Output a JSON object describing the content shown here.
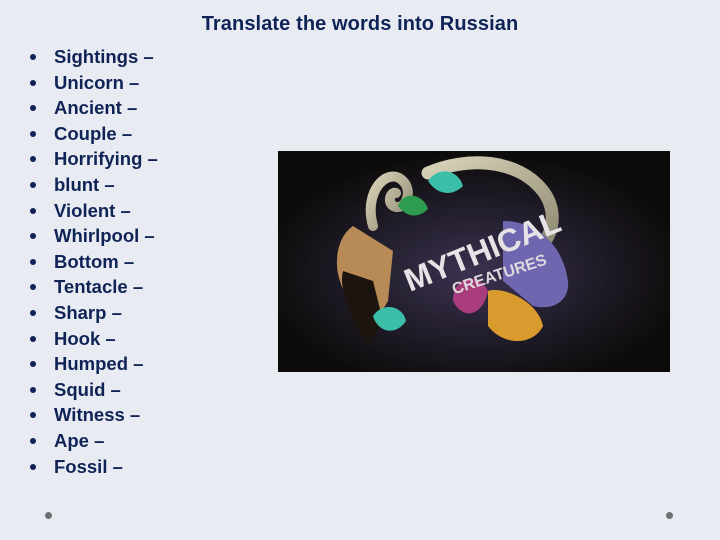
{
  "slide": {
    "title": "Translate the words into Russian",
    "words": [
      "Sightings –",
      "Unicorn –",
      "Ancient –",
      "Couple –",
      "Horrifying –",
      "blunt –",
      "Violent –",
      "Whirlpool –",
      "Bottom –",
      "Tentacle –",
      "Sharp –",
      "Hook –",
      "Humped –",
      "Squid –",
      "Witness –",
      "Ape –",
      "Fossil –"
    ],
    "image": {
      "title_line1": "MYTHICAL",
      "title_line2": "CREATURES",
      "description": "Mythical creatures illustration"
    }
  }
}
